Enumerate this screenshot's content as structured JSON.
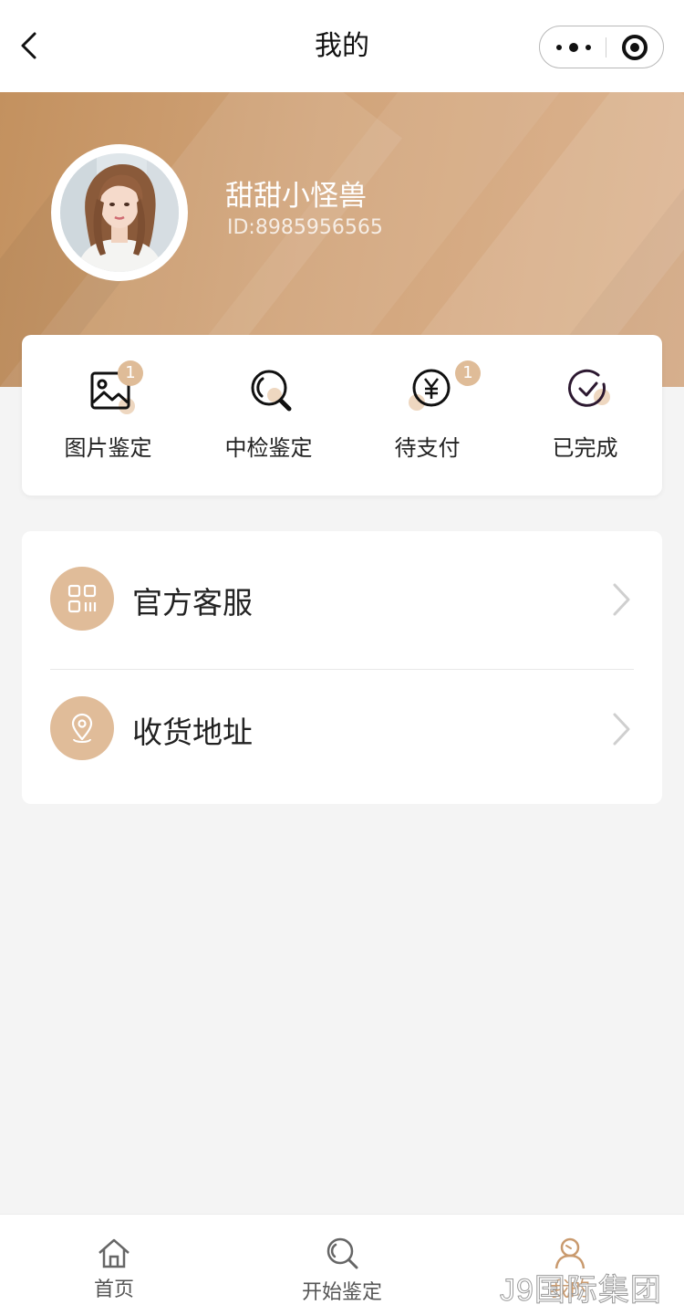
{
  "navbar": {
    "title": "我的",
    "back_icon": "chevron-left-icon",
    "more_icon": "more-dots-icon",
    "close_icon": "target-circle-icon"
  },
  "profile": {
    "name": "甜甜小怪兽",
    "id_text": "ID:8985956565",
    "avatar_icon": "user-avatar-photo"
  },
  "orders": [
    {
      "label": "图片鉴定",
      "icon": "image-icon",
      "badge": "1"
    },
    {
      "label": "中检鉴定",
      "icon": "magnifier-icon",
      "badge": ""
    },
    {
      "label": "待支付",
      "icon": "yen-coin-icon",
      "badge": "1"
    },
    {
      "label": "已完成",
      "icon": "check-circle-icon",
      "badge": ""
    }
  ],
  "menu": [
    {
      "label": "官方客服",
      "icon": "qr-grid-icon"
    },
    {
      "label": "收货地址",
      "icon": "location-pin-icon"
    }
  ],
  "tabbar": {
    "items": [
      {
        "label": "首页",
        "icon": "home-icon",
        "active": false
      },
      {
        "label": "开始鉴定",
        "icon": "search-icon",
        "active": false
      },
      {
        "label": "我的",
        "icon": "user-icon",
        "active": true
      }
    ]
  },
  "watermark": "J9国际集团",
  "colors": {
    "accent": "#dfbc98",
    "banner_start": "#c3915f",
    "banner_end": "#ddb592",
    "active_tab": "#c99a6e",
    "background": "#f4f4f4"
  }
}
